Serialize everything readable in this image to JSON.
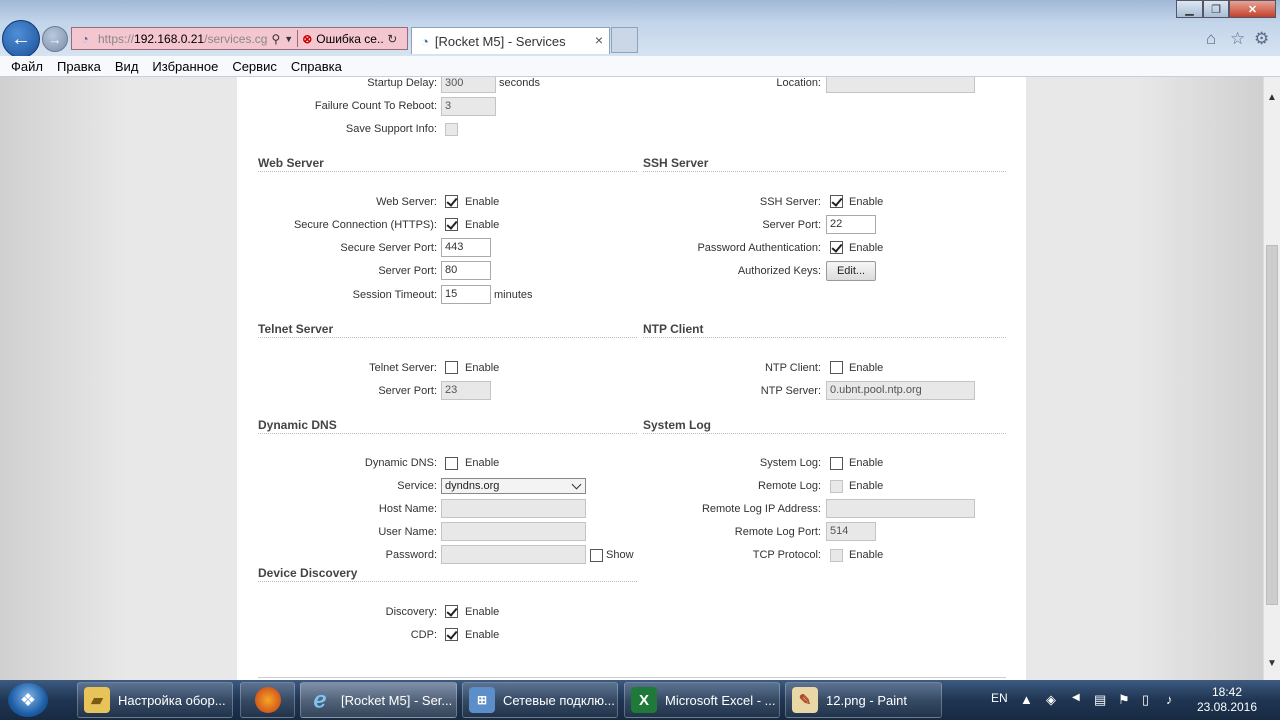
{
  "browser": {
    "address": {
      "prefix": "https://",
      "host": "192.168.0.21",
      "path": "/services.cg",
      "search_icon": "search-icon"
    },
    "error_tab": {
      "label": "Ошибка се..."
    },
    "active_tab": {
      "label": "[Rocket M5] - Services",
      "close": "×"
    },
    "menu": [
      "Файл",
      "Правка",
      "Вид",
      "Избранное",
      "Сервис",
      "Справка"
    ]
  },
  "general": {
    "startup_delay": {
      "label": "Startup Delay:",
      "value": "300",
      "unit": "seconds"
    },
    "failure_count": {
      "label": "Failure Count To Reboot:",
      "value": "3"
    },
    "save_support": {
      "label": "Save Support Info:"
    },
    "location": {
      "label": "Location:",
      "value": ""
    }
  },
  "web_server": {
    "title": "Web Server",
    "web_server": {
      "label": "Web Server:",
      "option": "Enable",
      "checked": true
    },
    "https": {
      "label": "Secure Connection (HTTPS):",
      "option": "Enable",
      "checked": true
    },
    "secure_port": {
      "label": "Secure Server Port:",
      "value": "443"
    },
    "server_port": {
      "label": "Server Port:",
      "value": "80"
    },
    "timeout": {
      "label": "Session Timeout:",
      "value": "15",
      "unit": "minutes"
    }
  },
  "ssh_server": {
    "title": "SSH Server",
    "ssh": {
      "label": "SSH Server:",
      "option": "Enable",
      "checked": true
    },
    "port": {
      "label": "Server Port:",
      "value": "22"
    },
    "password_auth": {
      "label": "Password Authentication:",
      "option": "Enable",
      "checked": true
    },
    "keys": {
      "label": "Authorized Keys:",
      "button": "Edit..."
    }
  },
  "telnet_server": {
    "title": "Telnet Server",
    "telnet": {
      "label": "Telnet Server:",
      "option": "Enable",
      "checked": false
    },
    "port": {
      "label": "Server Port:",
      "value": "23"
    }
  },
  "ntp_client": {
    "title": "NTP Client",
    "ntp": {
      "label": "NTP Client:",
      "option": "Enable",
      "checked": false
    },
    "server": {
      "label": "NTP Server:",
      "value": "0.ubnt.pool.ntp.org"
    }
  },
  "dynamic_dns": {
    "title": "Dynamic DNS",
    "ddns": {
      "label": "Dynamic DNS:",
      "option": "Enable",
      "checked": false
    },
    "service": {
      "label": "Service:",
      "value": "dyndns.org"
    },
    "host": {
      "label": "Host Name:",
      "value": ""
    },
    "user": {
      "label": "User Name:",
      "value": ""
    },
    "password": {
      "label": "Password:",
      "value": "",
      "show": "Show"
    }
  },
  "system_log": {
    "title": "System Log",
    "syslog": {
      "label": "System Log:",
      "option": "Enable",
      "checked": false
    },
    "remote": {
      "label": "Remote Log:",
      "option": "Enable"
    },
    "remote_ip": {
      "label": "Remote Log IP Address:",
      "value": ""
    },
    "remote_port": {
      "label": "Remote Log Port:",
      "value": "514"
    },
    "tcp": {
      "label": "TCP Protocol:",
      "option": "Enable"
    }
  },
  "device_discovery": {
    "title": "Device Discovery",
    "discovery": {
      "label": "Discovery:",
      "option": "Enable",
      "checked": true
    },
    "cdp": {
      "label": "CDP:",
      "option": "Enable",
      "checked": true
    }
  },
  "taskbar": {
    "items": [
      {
        "label": "Настройка обор...",
        "icon": "folder-icon"
      },
      {
        "label": "",
        "icon": "firefox-icon"
      },
      {
        "label": "[Rocket M5] - Ser...",
        "icon": "ie-icon"
      },
      {
        "label": "Сетевые подклю...",
        "icon": "network-icon"
      },
      {
        "label": "Microsoft Excel - ...",
        "icon": "excel-icon"
      },
      {
        "label": "12.png - Paint",
        "icon": "paint-icon"
      }
    ],
    "lang": "EN",
    "time": "18:42",
    "date": "23.08.2016"
  }
}
